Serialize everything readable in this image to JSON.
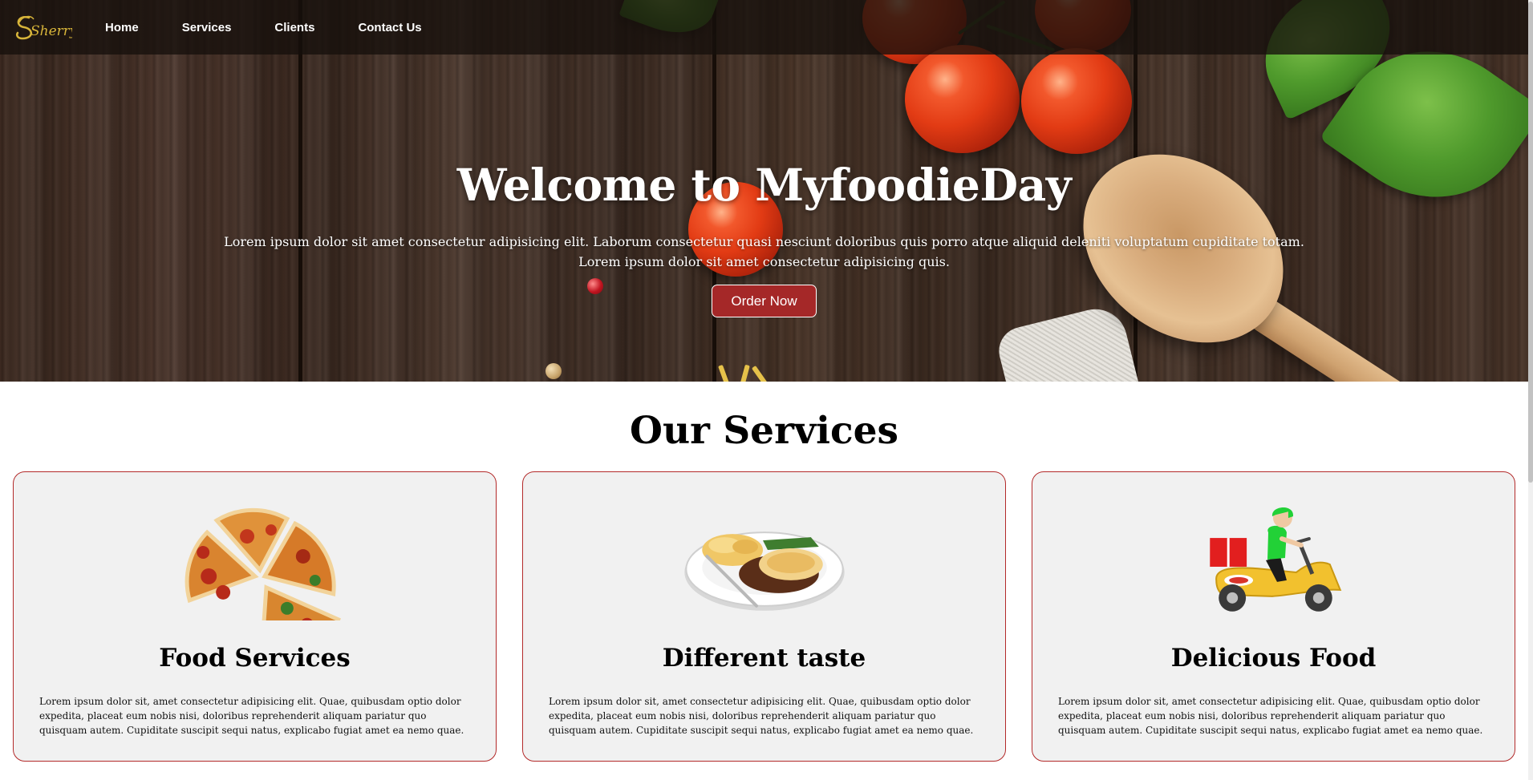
{
  "brand": {
    "logo_text": "Sherry",
    "accent_color": "#d8b53a"
  },
  "nav": {
    "items": [
      {
        "label": "Home"
      },
      {
        "label": "Services"
      },
      {
        "label": "Clients"
      },
      {
        "label": "Contact Us"
      }
    ]
  },
  "hero": {
    "title": "Welcome to MyfoodieDay",
    "text": "Lorem ipsum dolor sit amet consectetur adipisicing elit. Laborum consectetur quasi nesciunt doloribus quis porro atque aliquid deleniti voluptatum cupiditate totam. Lorem ipsum dolor sit amet consectetur adipisicing quis.",
    "button_label": "Order Now",
    "button_color": "#a52828"
  },
  "services": {
    "title": "Our Services",
    "card_border_color": "#b32a2a",
    "cards": [
      {
        "icon": "pizza-slices-image",
        "title": "Food Services",
        "text": "Lorem ipsum dolor sit, amet consectetur adipisicing elit. Quae, quibusdam optio dolor expedita, placeat eum nobis nisi, doloribus reprehenderit aliquam pariatur quo quisquam autem. Cupiditate suscipit sequi natus, explicabo fugiat amet ea nemo quae."
      },
      {
        "icon": "meal-plate-image",
        "title": "Different taste",
        "text": "Lorem ipsum dolor sit, amet consectetur adipisicing elit. Quae, quibusdam optio dolor expedita, placeat eum nobis nisi, doloribus reprehenderit aliquam pariatur quo quisquam autem. Cupiditate suscipit sequi natus, explicabo fugiat amet ea nemo quae."
      },
      {
        "icon": "delivery-scooter-image",
        "title": "Delicious Food",
        "text": "Lorem ipsum dolor sit, amet consectetur adipisicing elit. Quae, quibusdam optio dolor expedita, placeat eum nobis nisi, doloribus reprehenderit aliquam pariatur quo quisquam autem. Cupiditate suscipit sequi natus, explicabo fugiat amet ea nemo quae."
      }
    ]
  }
}
